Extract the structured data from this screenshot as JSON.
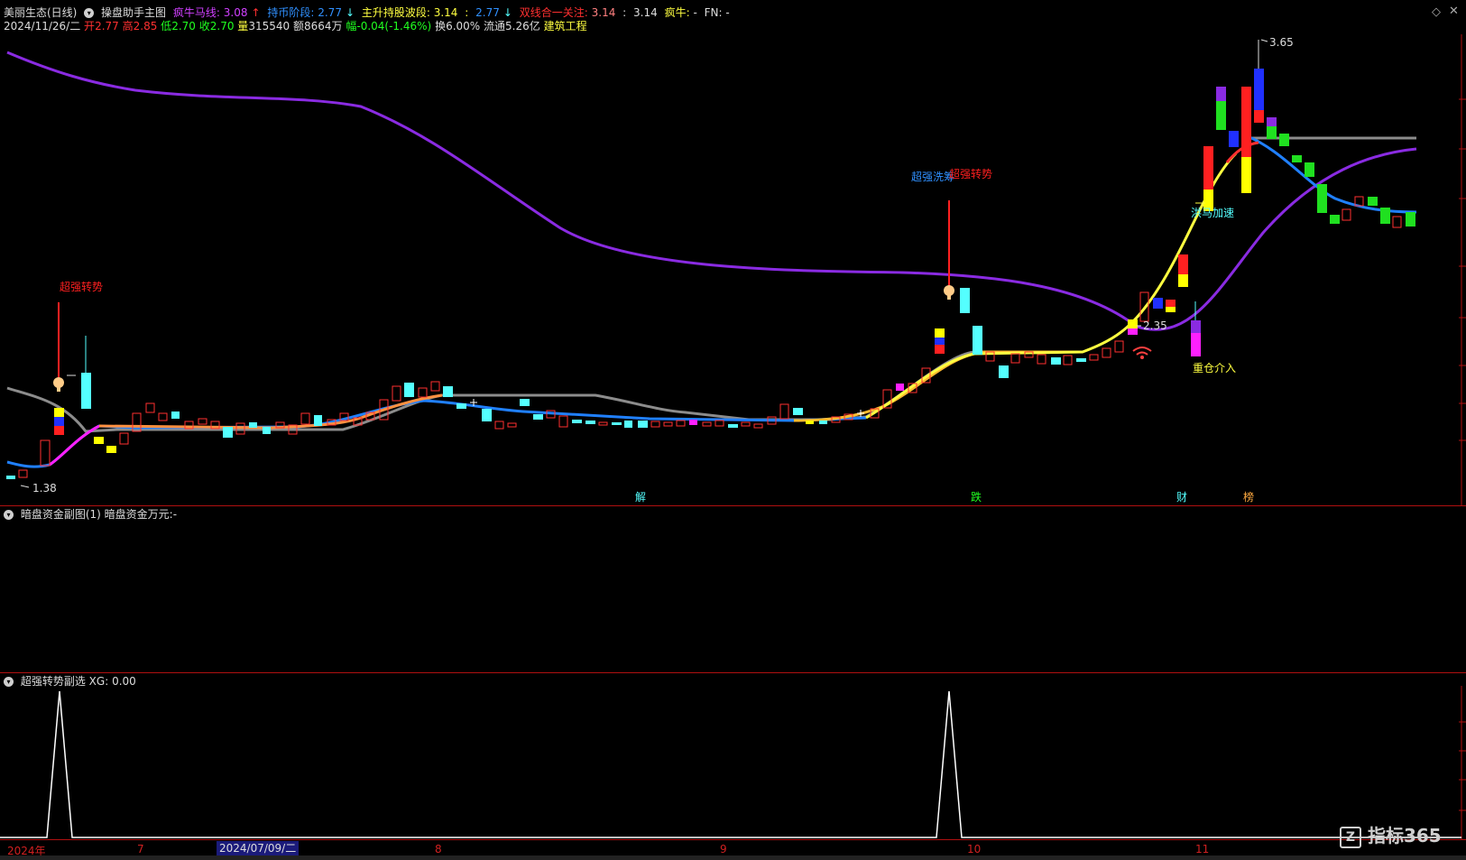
{
  "main": {
    "stock_name": "美丽生态(日线)",
    "indicator_name": "操盘助手主图",
    "ind1_label": "疯牛马线:",
    "ind1_value": "3.08",
    "ind2_label": "持币阶段:",
    "ind2_value": "2.77",
    "ind3_label": "主升持股波段:",
    "ind3_value1": "3.14",
    "ind3_value2": "2.77",
    "ind4_label": "双线合一关注:",
    "ind4_value1": "3.14",
    "ind4_value2": "3.14",
    "ind5_label": "疯牛:",
    "ind5_value": "-",
    "fn_label": "FN:",
    "fn_value": "-",
    "date": "2024/11/26/二",
    "open_label": "开",
    "open": "2.77",
    "high_label": "高",
    "high": "2.85",
    "low_label": "低",
    "low": "2.70",
    "close_label": "收",
    "close": "2.70",
    "volume_label": "量",
    "volume": "315540",
    "amount_label": "额",
    "amount": "8664万",
    "change_label": "幅",
    "change": "-0.04(-1.46%)",
    "turnover_label": "换",
    "turnover": "6.00%",
    "float_label": "流通",
    "float": "5.26亿",
    "sector": "建筑工程",
    "high_price_mark": "3.65",
    "low_price_mark": "1.38",
    "mid_price_mark": "2.35",
    "signal_1": "超强转势",
    "signal_2": "超强洗筹",
    "signal_3": "超强转势",
    "signal_4": "洪马加速",
    "signal_5": "重仓介入",
    "event_1": "解",
    "event_2": "跌",
    "event_3": "财",
    "event_4": "榜"
  },
  "sub1": {
    "title": "暗盘资金副图(1)",
    "label": "暗盘资金万元:",
    "value": "-"
  },
  "sub2": {
    "title": "超强转势副选",
    "label": "XG:",
    "value": "0.00",
    "peaks": [
      1,
      1
    ]
  },
  "axis": {
    "year": "2024年",
    "month_7": "7",
    "selected_date": "2024/07/09/二",
    "month_8": "8",
    "month_9": "9",
    "month_10": "10",
    "month_11": "11"
  },
  "brand": "指标365",
  "colors": {
    "background": "#000000",
    "up": "#ff3030",
    "down": "#54ffff",
    "grid": "#b01010",
    "purple_line": "#8a2be2",
    "blue_line": "#2080ff",
    "gray_line": "#8c8c8c",
    "yellow_line": "#ffff40"
  }
}
